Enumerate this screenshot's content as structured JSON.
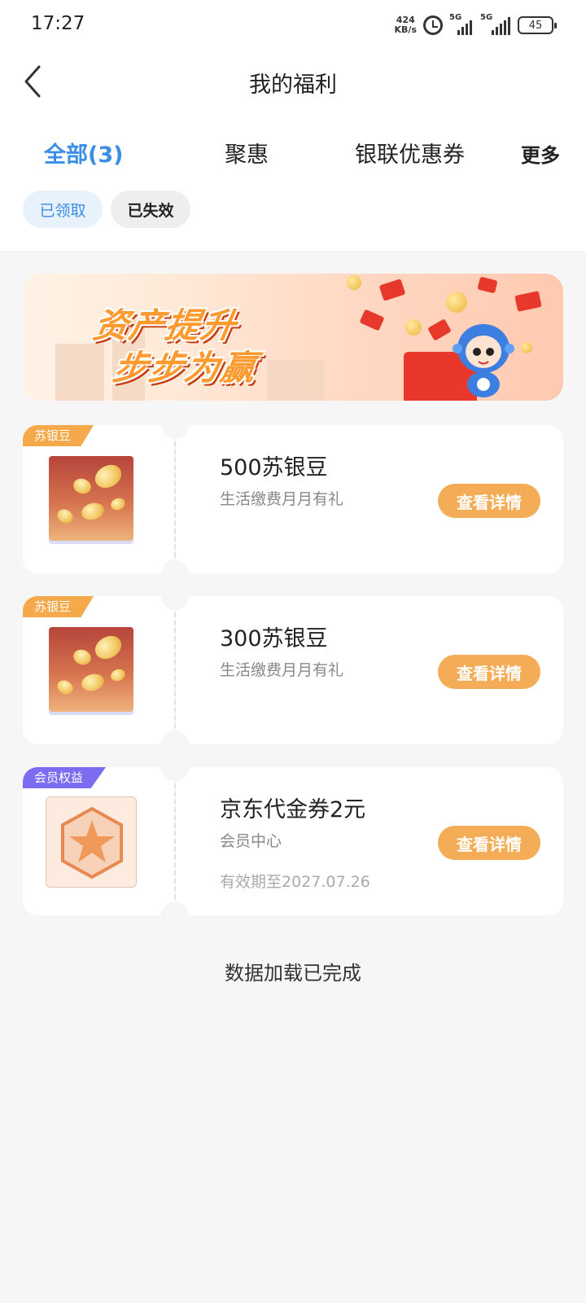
{
  "status_bar": {
    "time": "17:27",
    "net_speed_value": "424",
    "net_speed_unit": "KB/s",
    "signal1_label": "5G",
    "signal2_label": "5G",
    "battery": "45"
  },
  "header": {
    "title": "我的福利"
  },
  "tabs": [
    {
      "label": "全部(3)",
      "active": true
    },
    {
      "label": "聚惠",
      "active": false
    },
    {
      "label": "银联优惠券",
      "active": false
    }
  ],
  "tab_more_label": "更多",
  "filters": [
    {
      "label": "已领取",
      "selected": true
    },
    {
      "label": "已失效",
      "selected": false
    }
  ],
  "banner": {
    "line1": "资产提升",
    "line2": "步步为赢"
  },
  "cards": [
    {
      "tag": "苏银豆",
      "tag_color": "#f5a94b",
      "image": "golden-beans",
      "title": "500苏银豆",
      "subtitle": "生活缴费月月有礼",
      "expiry": "",
      "button": "查看详情"
    },
    {
      "tag": "苏银豆",
      "tag_color": "#f5a94b",
      "image": "golden-beans",
      "title": "300苏银豆",
      "subtitle": "生活缴费月月有礼",
      "expiry": "",
      "button": "查看详情"
    },
    {
      "tag": "会员权益",
      "tag_color": "#7b6cf2",
      "image": "star-hexagon",
      "title": "京东代金券2元",
      "subtitle": "会员中心",
      "expiry": "有效期至2027.07.26",
      "button": "查看详情"
    }
  ],
  "footer": {
    "note": "数据加载已完成"
  },
  "colors": {
    "accent_blue": "#3a8ee6",
    "button_orange": "#f5ac57",
    "background": "#f6f6f6"
  }
}
